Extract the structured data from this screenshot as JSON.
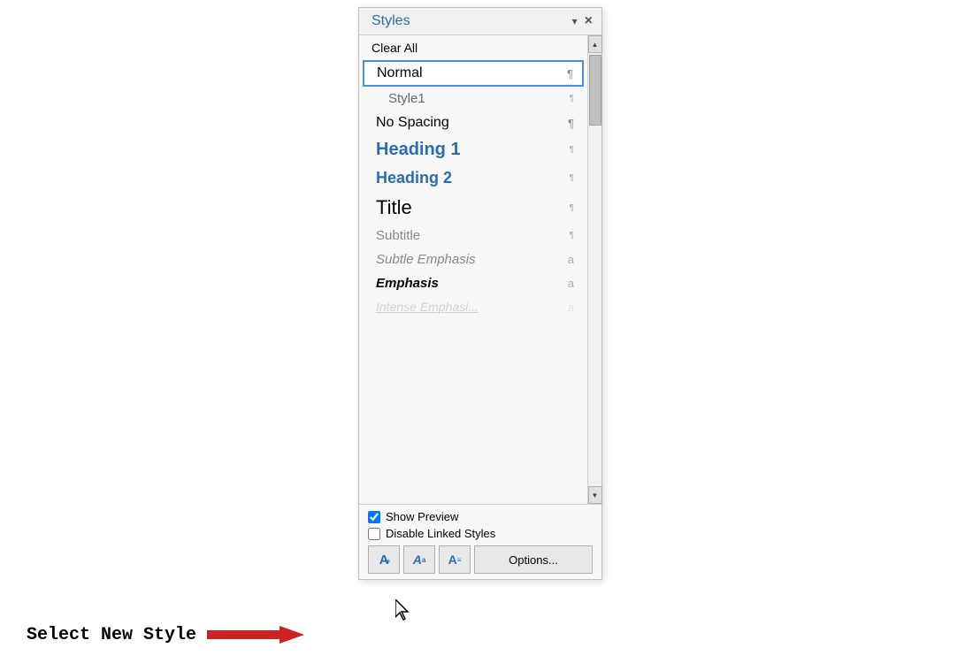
{
  "panel": {
    "title": "Styles",
    "close_label": "×",
    "dropdown_label": "▾"
  },
  "styles": {
    "clear_all": "Clear All",
    "items": [
      {
        "id": "normal",
        "label": "Normal",
        "icon": "¶",
        "icon_type": "pilcrow",
        "style_class": "style-normal",
        "selected": true
      },
      {
        "id": "style1",
        "label": "Style1",
        "icon": "¶",
        "icon_type": "pilcrow-small",
        "style_class": "style-style1",
        "selected": false
      },
      {
        "id": "no-spacing",
        "label": "No Spacing",
        "icon": "¶",
        "icon_type": "pilcrow",
        "style_class": "style-nospacing",
        "selected": false
      },
      {
        "id": "heading1",
        "label": "Heading 1",
        "icon": "¶",
        "icon_type": "pilcrow-small",
        "style_class": "style-heading1",
        "selected": false
      },
      {
        "id": "heading2",
        "label": "Heading 2",
        "icon": "¶",
        "icon_type": "pilcrow-small",
        "style_class": "style-heading2",
        "selected": false
      },
      {
        "id": "title",
        "label": "Title",
        "icon": "¶",
        "icon_type": "pilcrow-small",
        "style_class": "style-title",
        "selected": false
      },
      {
        "id": "subtitle",
        "label": "Subtitle",
        "icon": "¶",
        "icon_type": "pilcrow-small",
        "style_class": "style-subtitle",
        "selected": false
      },
      {
        "id": "subtle-emphasis",
        "label": "Subtle Emphasis",
        "icon": "a",
        "icon_type": "alpha",
        "style_class": "style-subtle-emphasis",
        "selected": false
      },
      {
        "id": "emphasis",
        "label": "Emphasis",
        "icon": "a",
        "icon_type": "alpha",
        "style_class": "style-emphasis",
        "selected": false
      },
      {
        "id": "faded",
        "label": "Intense Emphasi...",
        "icon": "a",
        "icon_type": "alpha",
        "style_class": "style-faded",
        "selected": false
      }
    ]
  },
  "footer": {
    "show_preview_label": "Show Preview",
    "show_preview_checked": true,
    "disable_linked_label": "Disable Linked Styles",
    "disable_linked_checked": false,
    "options_label": "Options...",
    "btn1_icon": "A",
    "btn2_icon": "A",
    "btn3_icon": "A"
  },
  "bottom_label": {
    "text": "Select New Style"
  },
  "colors": {
    "heading_blue": "#2b6cb0",
    "arrow_red": "#cc2222"
  }
}
